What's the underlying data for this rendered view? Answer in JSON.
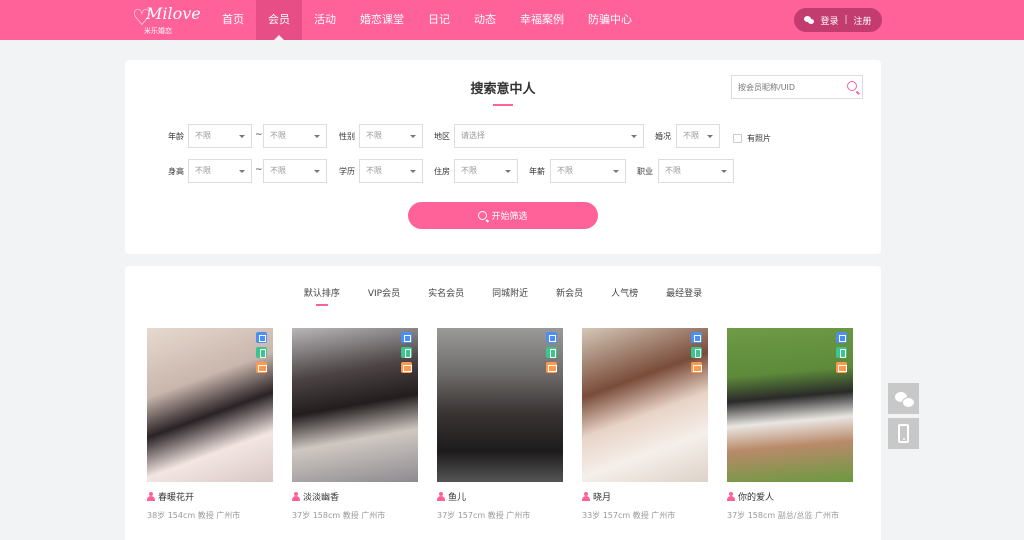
{
  "header": {
    "logo_text": "Milove",
    "logo_sub": "米乐婚恋",
    "nav": [
      "首页",
      "会员",
      "活动",
      "婚恋课堂",
      "日记",
      "动态",
      "幸福案例",
      "防骗中心"
    ],
    "active_nav": "会员",
    "login": "登录",
    "separator": "|",
    "register": "注册"
  },
  "search": {
    "title": "搜索意中人",
    "uid_placeholder": "按会员昵称/UID",
    "tilde": "~",
    "labels": {
      "age": "年龄",
      "gender": "性别",
      "region": "地区",
      "marital": "婚况",
      "has_photo": "有照片",
      "height": "身高",
      "education": "学历",
      "housing": "住房",
      "salary": "年薪",
      "occupation": "职业"
    },
    "values": {
      "age_min": "不限",
      "age_max": "不限",
      "gender": "不限",
      "region": "请选择",
      "marital": "不限",
      "height_min": "不限",
      "height_max": "不限",
      "education": "不限",
      "housing": "不限",
      "salary": "不限",
      "occupation": "不限"
    },
    "start_button": "开始筛选"
  },
  "sort_tabs": [
    "默认排序",
    "VIP会员",
    "实名会员",
    "同城附近",
    "新会员",
    "人气榜",
    "最经登录"
  ],
  "active_sort": "默认排序",
  "members": [
    {
      "name": "春暖花开",
      "info": "38岁 154cm 教授 广州市"
    },
    {
      "name": "淡淡幽香",
      "info": "37岁 158cm 教授 广州市"
    },
    {
      "name": "鱼儿",
      "info": "37岁 157cm 教授 广州市"
    },
    {
      "name": "晓月",
      "info": "33岁 157cm 教授 广州市"
    },
    {
      "name": "你的爱人",
      "info": "37岁 158cm 副总/总监 广州市"
    }
  ],
  "colors": {
    "brand": "#ff6199",
    "brand_dark": "#e84e86",
    "pill": "#c23c6f",
    "badge_id": "#4a8ff5",
    "badge_phone": "#3dc48f",
    "badge_mail": "#ff9a4d"
  },
  "icons": [
    "wechat-icon",
    "search-icon",
    "chevron-down-icon",
    "person-icon",
    "id-card-icon",
    "phone-icon",
    "mail-icon"
  ]
}
